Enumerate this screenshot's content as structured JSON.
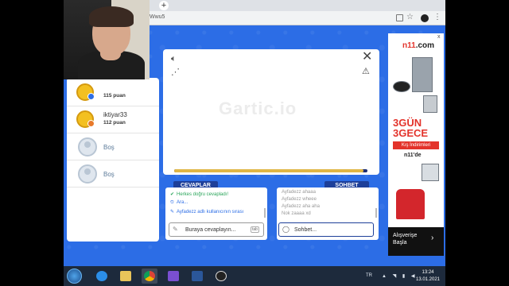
{
  "browser": {
    "url": "Wwu5",
    "new_tab": "+",
    "icons": {
      "translate": "translate-icon",
      "star": "star-icon",
      "extension": "extension-icon",
      "menu": "menu-icon"
    }
  },
  "players": [
    {
      "name": "",
      "score": "115 puan",
      "state": "ranked"
    },
    {
      "name": "iktiyar33",
      "score": "112 puan",
      "state": "ranked"
    },
    {
      "name": "Boş",
      "score": "",
      "state": "empty"
    },
    {
      "name": "Boş",
      "score": "",
      "state": "empty"
    }
  ],
  "canvas": {
    "watermark": "Gartic.io",
    "timer_fraction": 0.98,
    "icons": {
      "sound": "speaker-icon",
      "share": "share-icon",
      "close": "close-icon",
      "report": "alert-icon"
    }
  },
  "answers": {
    "tab_label": "CEVAPLAR",
    "messages": [
      {
        "icon": "✔",
        "text": "Herkes doğru cevapladı!",
        "color": "green"
      },
      {
        "icon": "⏲",
        "text": "Ara...",
        "color": "blue"
      },
      {
        "icon": "✎",
        "text": "Ayfadezz adlı kullanıcının sırası",
        "color": "blue"
      }
    ],
    "placeholder": "Buraya cevaplayın...",
    "tab_key": "tab"
  },
  "chat": {
    "tab_label": "SOHBET",
    "messages": [
      "Ayfadezz ahaaa",
      "Ayfadezz wheee",
      "Ayfadezz aha aha",
      "Nok zaaaa xd"
    ],
    "placeholder": "Sohbet..."
  },
  "ad": {
    "close": "x",
    "logo_prefix": "n",
    "logo_mid": "11",
    "logo_suffix": ".com",
    "title_line1": "3GÜN",
    "title_line2": "3GECE",
    "subtitle": "Kış İndirimleri",
    "brand": "n11'de",
    "cta_line1": "Alışverişe",
    "cta_line2": "Başla",
    "cta_arrow": "›",
    "colors": {
      "brand_red": "#e3332b"
    }
  },
  "taskbar": {
    "apps": [
      "internet-explorer-icon",
      "file-explorer-icon",
      "chrome-icon",
      "media-icon",
      "word-icon",
      "obs-icon"
    ],
    "language": "TR",
    "tray": "▲ ◥ ▮ ◀",
    "time": "13:24",
    "date": "13.01.2021"
  }
}
